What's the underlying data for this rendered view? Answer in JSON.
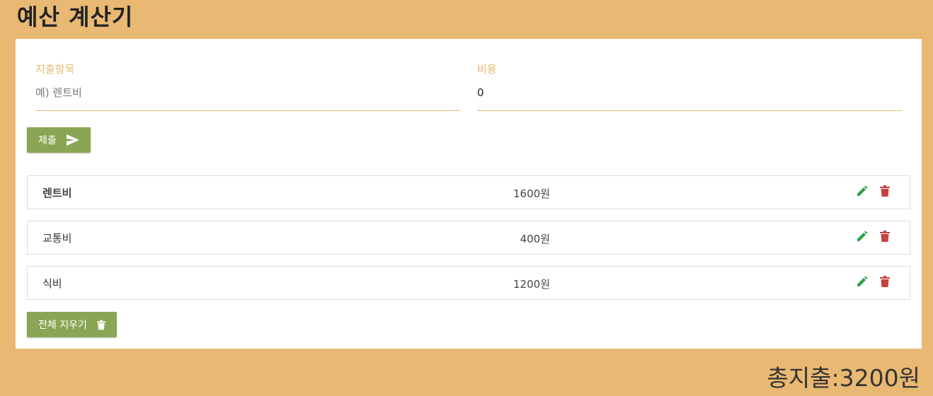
{
  "header": {
    "title": "예산 계산기"
  },
  "form": {
    "name_label": "지출항목",
    "name_placeholder": "예) 렌트비",
    "cost_label": "비용",
    "cost_value": "0",
    "submit_label": "제출"
  },
  "expenses": [
    {
      "name": "렌트비",
      "cost": "1600원"
    },
    {
      "name": "교통비",
      "cost": "400원"
    },
    {
      "name": "식비",
      "cost": "1200원"
    }
  ],
  "clear_label": "전체 지우기",
  "total": "총지출:3200원",
  "colors": {
    "background": "#e9b872",
    "button": "#8aa654",
    "edit": "#2e9e46",
    "delete": "#c9403f"
  },
  "icons": {
    "submit": "send-icon",
    "edit": "pencil-icon",
    "delete": "trash-icon"
  }
}
